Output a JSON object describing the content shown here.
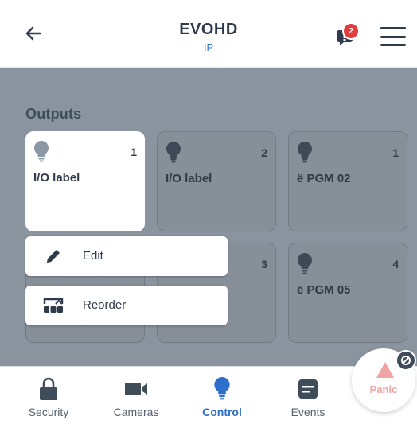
{
  "header": {
    "title": "EVOHD",
    "subtitle": "IP",
    "back_icon": "arrow-left-icon",
    "notification_icon": "message-icon",
    "notification_count": "2",
    "menu_icon": "hamburger-menu-icon"
  },
  "section": {
    "title": "Outputs"
  },
  "outputs": [
    {
      "number": "1",
      "label": "I/O label",
      "icon": "lightbulb-icon",
      "state": "selected"
    },
    {
      "number": "2",
      "label": "I/O label",
      "icon": "lightbulb-icon",
      "state": "dimmed"
    },
    {
      "number": "1",
      "label": "ë  PGM 02",
      "icon": "lightbulb-icon",
      "state": "dimmed"
    },
    {
      "number": "",
      "label": "",
      "icon": "",
      "state": "hidden-by-menu"
    },
    {
      "number": "3",
      "label": "",
      "icon": "",
      "state": "dimmed"
    },
    {
      "number": "4",
      "label": "ë  PGM 05",
      "icon": "lightbulb-icon",
      "state": "dimmed"
    }
  ],
  "context_menu": {
    "items": [
      {
        "label": "Edit",
        "icon": "pencil-icon"
      },
      {
        "label": "Reorder",
        "icon": "reorder-icon"
      }
    ]
  },
  "bottom_nav": {
    "items": [
      {
        "label": "Security",
        "icon": "lock-icon",
        "active": false
      },
      {
        "label": "Cameras",
        "icon": "video-camera-icon",
        "active": false
      },
      {
        "label": "Control",
        "icon": "lightbulb-icon",
        "active": true
      },
      {
        "label": "Events",
        "icon": "list-icon",
        "active": false
      }
    ],
    "panic": {
      "label": "Panic",
      "icon": "warning-triangle-icon",
      "status_icon": "disabled-icon"
    }
  },
  "colors": {
    "overlay": "#8a949e",
    "accent": "#2e6fcc",
    "badge": "#e23d3d",
    "panic": "#f1a4a4",
    "text": "#2f3a4a"
  }
}
